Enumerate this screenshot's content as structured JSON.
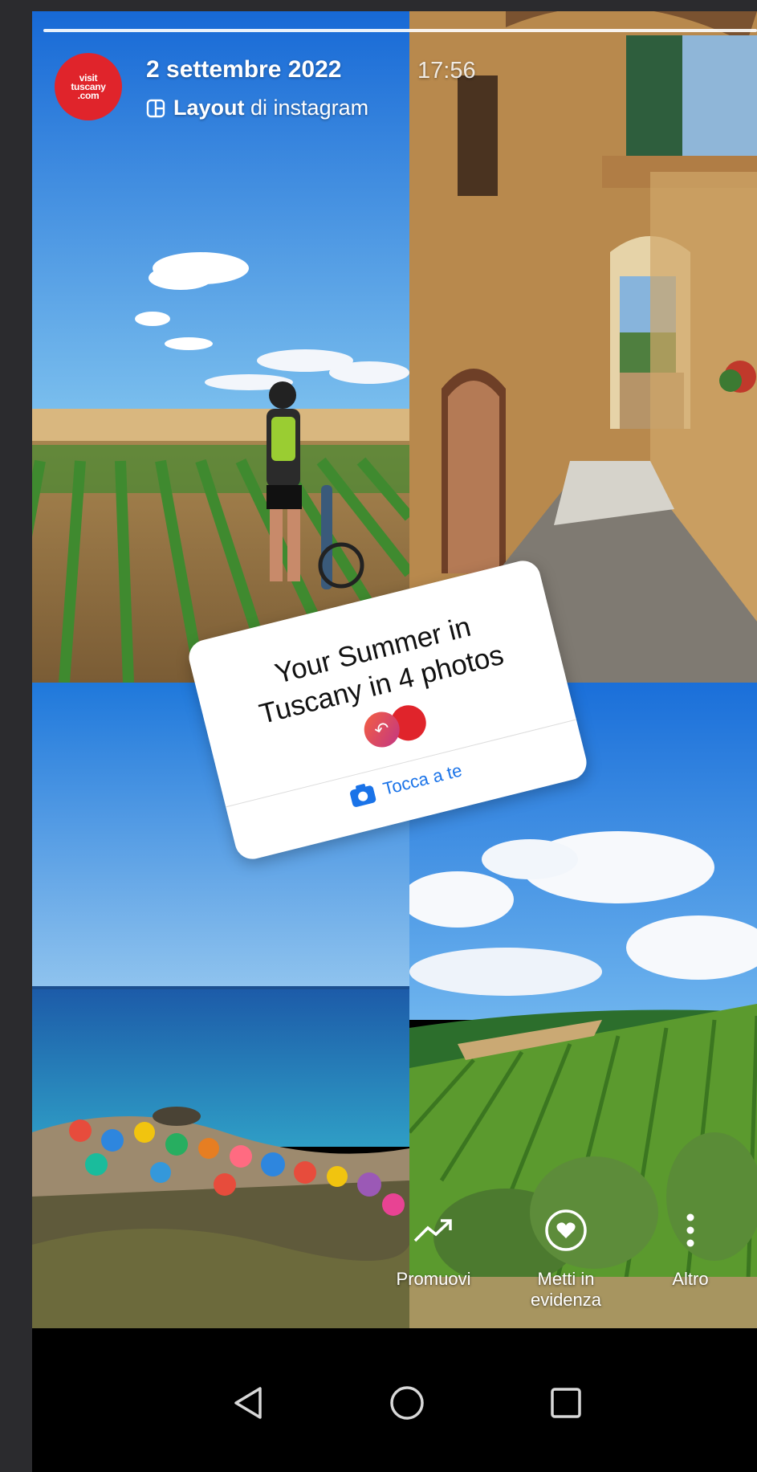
{
  "story": {
    "date": "2 settembre 2022",
    "time": "17:56",
    "layout_bold": "Layout",
    "layout_rest": " di instagram",
    "avatar_lines": [
      "visit",
      "tuscany",
      ".com"
    ]
  },
  "sticker": {
    "title": "Your Summer in Tuscany in 4 photos",
    "cta": "Tocca a te"
  },
  "actions": {
    "promote": "Promuovi",
    "highlight": "Metti in evidenza",
    "more": "Altro"
  },
  "icons": {
    "layout": "layout-grid-icon",
    "camera": "camera-icon",
    "promote": "trending-up-icon",
    "highlight": "heart-circle-icon",
    "more": "more-vertical-icon",
    "nav_back": "triangle-back-icon",
    "nav_home": "circle-home-icon",
    "nav_recents": "square-recents-icon"
  },
  "colors": {
    "brand_red": "#e0242b",
    "link_blue": "#1a73e8",
    "background": "#2b2b2e"
  }
}
